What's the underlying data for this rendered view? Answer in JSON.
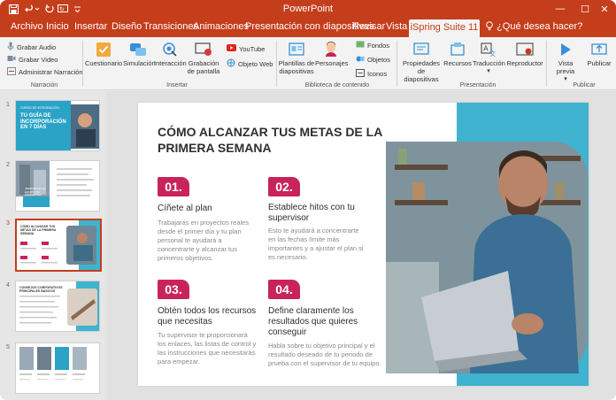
{
  "app": {
    "title": "PowerPoint",
    "controls": {
      "minimize": "—",
      "maximize": "☐",
      "close": "✕"
    }
  },
  "tabs": [
    "Archivo",
    "Inicio",
    "Insertar",
    "Diseño",
    "Transiciones",
    "Animaciones",
    "Presentación con diapositivas",
    "Revisar",
    "Vista"
  ],
  "active_tab": "iSpring Suite 11",
  "tell_me": "¿Qué desea hacer?",
  "ribbon": {
    "narracion": {
      "items": [
        "Grabar Audio",
        "Grabar Video",
        "Administrar Narración"
      ],
      "label": "Narración"
    },
    "insertar": {
      "buttons": [
        "Cuestionario",
        "Simulación",
        "Interacción",
        "Grabación de pantalla"
      ],
      "small": [
        "YouTube",
        "Objeto Web"
      ],
      "label": "Insertar"
    },
    "biblioteca": {
      "buttons": [
        "Plantillas de diapositivas",
        "Personajes"
      ],
      "small": [
        "Fondos",
        "Objetos",
        "Iconos"
      ],
      "label": "Biblioteca de contenido"
    },
    "presentacion": {
      "buttons": [
        "Propiedades de diapositivas",
        "Recursos",
        "Traducción",
        "Reproductor"
      ],
      "label": "Presentación"
    },
    "publicar": {
      "buttons": [
        "Vista previa",
        "Publicar"
      ],
      "label": "Publicar"
    }
  },
  "thumbnails": {
    "numbers": [
      "1",
      "2",
      "3",
      "4",
      "5"
    ],
    "slide1": {
      "small": "CURSO DE INTEGRACIÓN",
      "title": "TU GUÍA DE INCORPORACIÓN EN 7 DÍAS"
    },
    "slide2": {
      "title": "¡BIENVENIDO AL EQUIPO DE MARKETING!"
    },
    "slide3": {
      "title": "CÓMO ALCANZAR TUS METAS DE LA PRIMERA SEMANA"
    },
    "slide4": {
      "title": "CONSEJOS CORPORATIVOS PRINCIPALES BÁSICOS"
    }
  },
  "slide": {
    "title": "CÓMO ALCANZAR TUS METAS DE LA PRIMERA SEMANA",
    "points": [
      {
        "num": "01.",
        "title": "Cíñete al plan",
        "body": "Trabajarás en proyectos reales desde el primer día y tu plan personal te ayudará a concentrarte y alcanzar tus primeros objetivos."
      },
      {
        "num": "02.",
        "title": "Establece hitos con tu supervisor",
        "body": "Esto te ayudará a concentrarte en las fechas límite más importantes y a ajustar el plan si es necesario."
      },
      {
        "num": "03.",
        "title": "Obtén todos los recursos que necesitas",
        "body": "Tu supervisor te proporcionará los enlaces, las listas de control y las instrucciones que necesitarás para empezar."
      },
      {
        "num": "04.",
        "title": "Define claramente los resultados que quieres conseguir",
        "body": "Habla sobre tu objetivo principal y el resultado deseado de tu periodo de prueba con el supervisor de tu equipo."
      }
    ]
  },
  "colors": {
    "brand": "#c43e1c",
    "accent": "#c8245b",
    "teal": "#3fb3cf"
  },
  "icons": [
    "save-icon",
    "undo-icon",
    "redo-icon",
    "start-from-beginning-icon",
    "customize-icon",
    "lightbulb-icon"
  ]
}
